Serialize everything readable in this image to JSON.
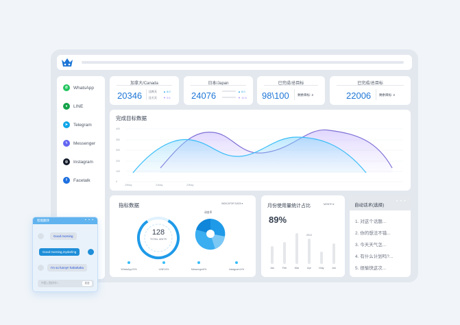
{
  "sidebar": {
    "items": [
      {
        "label": "WhatsApp",
        "icon": "whatsapp-icon",
        "color": "#22c55e"
      },
      {
        "label": "LINE",
        "icon": "line-icon",
        "color": "#16a34a"
      },
      {
        "label": "Telegram",
        "icon": "telegram-icon",
        "color": "#0ea5e9"
      },
      {
        "label": "Messenger",
        "icon": "messenger-icon",
        "color": "#6366f1"
      },
      {
        "label": "Instagram",
        "icon": "instagram-icon",
        "color": "#111827"
      },
      {
        "label": "Facetalk",
        "icon": "facebook-icon",
        "color": "#1d6fe0"
      }
    ]
  },
  "stats": [
    {
      "title": "加拿大/Canada",
      "value": "20346",
      "row1": "比昨天",
      "row1_val": "▲ 8.0",
      "row2": "比七天",
      "row2_val": "▼ 5.6"
    },
    {
      "title": "日本/Japan",
      "value": "24076",
      "row1": "",
      "row1_val": "▲ 8.0",
      "row2": "",
      "row2_val": "▼ 10.6"
    },
    {
      "title": "已完成/总目标",
      "value": "98\\100",
      "note": "剩余目标: 2"
    },
    {
      "title": "已完成/总目标",
      "value": "22006",
      "note": "剩余目标: 2"
    }
  ],
  "main_chart": {
    "title": "完成目标数据",
    "y_ticks": [
      "400",
      "350",
      "300",
      "200",
      "100",
      "50",
      "0"
    ],
    "x_ticks": [
      "20May",
      "21May",
      "22May"
    ]
  },
  "indicators": {
    "title": "指标数据",
    "dropdown": "INDICATOR DATA ▾",
    "total_value": "128",
    "total_label": "TOTAL UNITS",
    "pie_label": "调查率",
    "legend": [
      "WhatsApp74%",
      "LINE19%",
      "Messenger6%",
      "Instagram11%"
    ]
  },
  "monthly": {
    "title": "月份使用量统计占比",
    "dropdown": "MONTH ▾",
    "percent": "89%",
    "peak_label": "23.0",
    "months": [
      "Jan",
      "Feb",
      "Mar",
      "Apr",
      "May",
      "Jun"
    ]
  },
  "phrases": {
    "title": "自动话术(选择)",
    "items": [
      "1. 对这个话题...",
      "2. 你的想法不错...",
      "3. 今天天气怎...",
      "4. 有什么计划吗?...",
      "5. 很愉快这次..."
    ]
  },
  "chat": {
    "title": "智能翻译",
    "messages": [
      "Good morning",
      "Good morning,mydarling",
      "I'm so funny!! hahahaha"
    ],
    "input_placeholder": "中国 | 您好吗?...",
    "send_label": "发送"
  }
}
